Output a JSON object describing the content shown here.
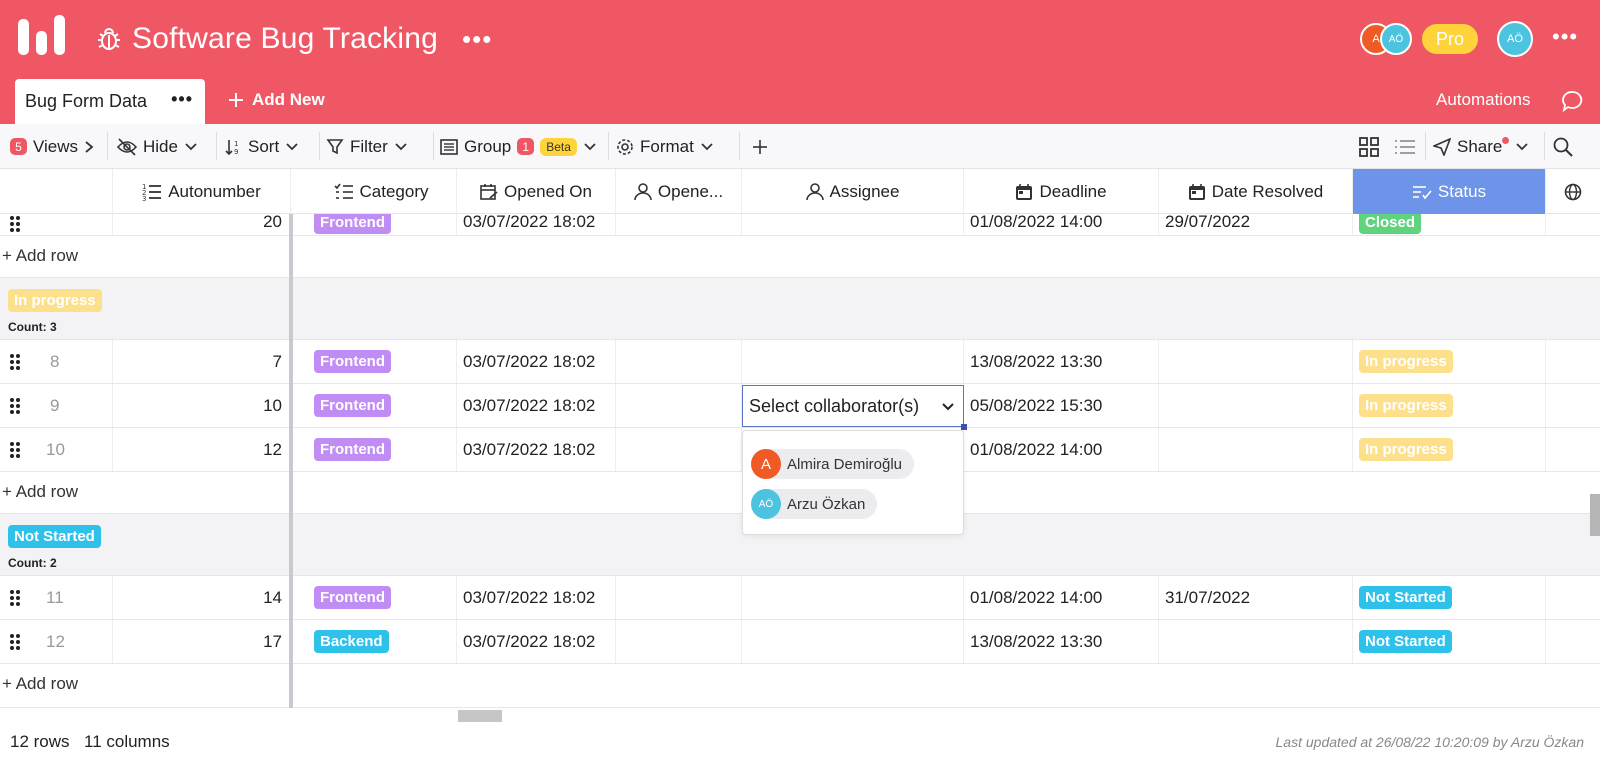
{
  "app": {
    "title": "Software Bug Tracking",
    "title_more": "•••",
    "pro_label": "Pro",
    "header_more": "•••",
    "avatars": [
      {
        "initials": "A",
        "color": "#f05a24"
      },
      {
        "initials": "AÖ",
        "color": "#4cc4e0"
      },
      {
        "initials": "AÖ",
        "color": "#4cc4e0"
      }
    ],
    "accent": "#ef5765"
  },
  "tabs": {
    "active": "Bug Form Data",
    "active_more": "•••",
    "add_new": "Add New",
    "automations": "Automations"
  },
  "toolbar": {
    "views_count": "5",
    "views": "Views",
    "hide": "Hide",
    "sort": "Sort",
    "filter": "Filter",
    "group": "Group",
    "group_count": "1",
    "beta": "Beta",
    "format": "Format",
    "share": "Share"
  },
  "columns": {
    "autonumber": "Autonumber",
    "category": "Category",
    "opened_on": "Opened On",
    "opened_by": "Opene...",
    "assignee": "Assignee",
    "deadline": "Deadline",
    "date_resolved": "Date Resolved",
    "status": "Status"
  },
  "top_partial_row": {
    "autonumber": "20",
    "category": "Frontend",
    "opened_on": "03/07/2022 18:02",
    "deadline": "01/08/2022 14:00",
    "date_resolved": "29/07/2022",
    "status": "Closed"
  },
  "add_row": "+ Add row",
  "groups": [
    {
      "label": "In progress",
      "color": "#fde08c",
      "count": "Count: 3",
      "rows": [
        {
          "num": "8",
          "autonumber": "7",
          "category": "Frontend",
          "category_color": "#c08df5",
          "opened_on": "03/07/2022 18:02",
          "assignee": "",
          "deadline": "13/08/2022 13:30",
          "date_resolved": "",
          "status": "In progress"
        },
        {
          "num": "9",
          "autonumber": "10",
          "category": "Frontend",
          "category_color": "#c08df5",
          "opened_on": "03/07/2022 18:02",
          "assignee": "Select collaborator(s)",
          "deadline": "05/08/2022 15:30",
          "date_resolved": "",
          "status": "In progress"
        },
        {
          "num": "10",
          "autonumber": "12",
          "category": "Frontend",
          "category_color": "#c08df5",
          "opened_on": "03/07/2022 18:02",
          "assignee": "",
          "deadline": "01/08/2022 14:00",
          "date_resolved": "",
          "status": "In progress"
        }
      ]
    },
    {
      "label": "Not Started",
      "color": "#2ec1ea",
      "count": "Count: 2",
      "rows": [
        {
          "num": "11",
          "autonumber": "14",
          "category": "Frontend",
          "category_color": "#c08df5",
          "opened_on": "03/07/2022 18:02",
          "assignee": "",
          "deadline": "01/08/2022 14:00",
          "date_resolved": "31/07/2022",
          "status": "Not Started"
        },
        {
          "num": "12",
          "autonumber": "17",
          "category": "Backend",
          "category_color": "#2ec1ea",
          "opened_on": "03/07/2022 18:02",
          "assignee": "",
          "deadline": "13/08/2022 13:30",
          "date_resolved": "",
          "status": "Not Started"
        }
      ]
    }
  ],
  "collaborators": [
    {
      "initials": "A",
      "name": "Almira Demiroğlu",
      "color": "#f05a24"
    },
    {
      "initials": "AÖ",
      "name": "Arzu Özkan",
      "color": "#4cc4e0"
    }
  ],
  "footer": {
    "rows": "12 rows",
    "columns": "11 columns",
    "last_updated": "Last updated at 26/08/22 10:20:09 by Arzu Özkan"
  }
}
